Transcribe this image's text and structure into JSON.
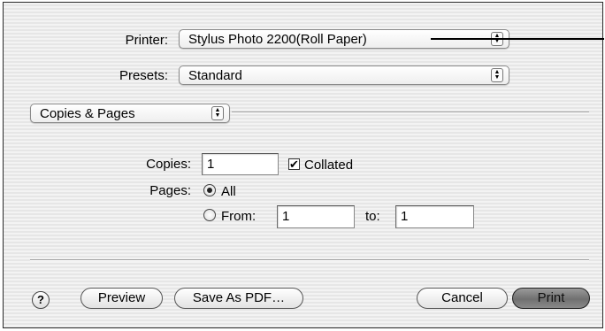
{
  "printer": {
    "label": "Printer:",
    "value": "Stylus Photo 2200(Roll Paper)"
  },
  "presets": {
    "label": "Presets:",
    "value": "Standard"
  },
  "section": {
    "value": "Copies & Pages"
  },
  "copies": {
    "label": "Copies:",
    "value": "1",
    "collated_label": "Collated",
    "collated_checked": true,
    "checkmark": "✔"
  },
  "pages": {
    "label": "Pages:",
    "all_label": "All",
    "all_selected": true,
    "from_label": "From:",
    "from_value": "1",
    "to_label": "to:",
    "to_value": "1"
  },
  "buttons": {
    "help": "?",
    "preview": "Preview",
    "save_pdf": "Save As PDF…",
    "cancel": "Cancel",
    "print": "Print"
  },
  "popup_arrows": "▲▼"
}
